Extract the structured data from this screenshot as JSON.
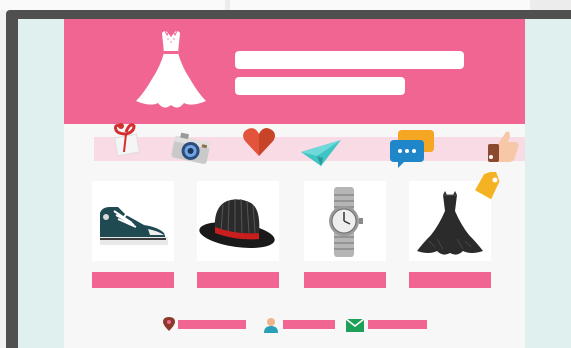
{
  "colors": {
    "accent_pink": "#f06592",
    "band_pink": "#f9dbe6",
    "screen_mint": "#dff0ee",
    "monitor_frame": "#505050",
    "page_bg": "#f7f7f7"
  },
  "header": {
    "title_line": "",
    "subtitle_line": "",
    "hero_icon": "dress-icon"
  },
  "icon_band": {
    "icons": [
      "gift-icon",
      "camera-icon",
      "heart-icon",
      "paper-plane-icon",
      "chat-bubbles-icon",
      "thumbs-up-icon"
    ]
  },
  "products": [
    {
      "icon": "sneaker-icon",
      "button_label": ""
    },
    {
      "icon": "fedora-hat-icon",
      "button_label": ""
    },
    {
      "icon": "wristwatch-icon",
      "button_label": ""
    },
    {
      "icon": "black-dress-icon",
      "button_label": "",
      "badge": "price-tag-icon"
    }
  ],
  "footer": {
    "items": [
      {
        "icon": "location-pin-icon",
        "text": ""
      },
      {
        "icon": "user-icon",
        "text": ""
      },
      {
        "icon": "envelope-icon",
        "text": ""
      }
    ]
  }
}
